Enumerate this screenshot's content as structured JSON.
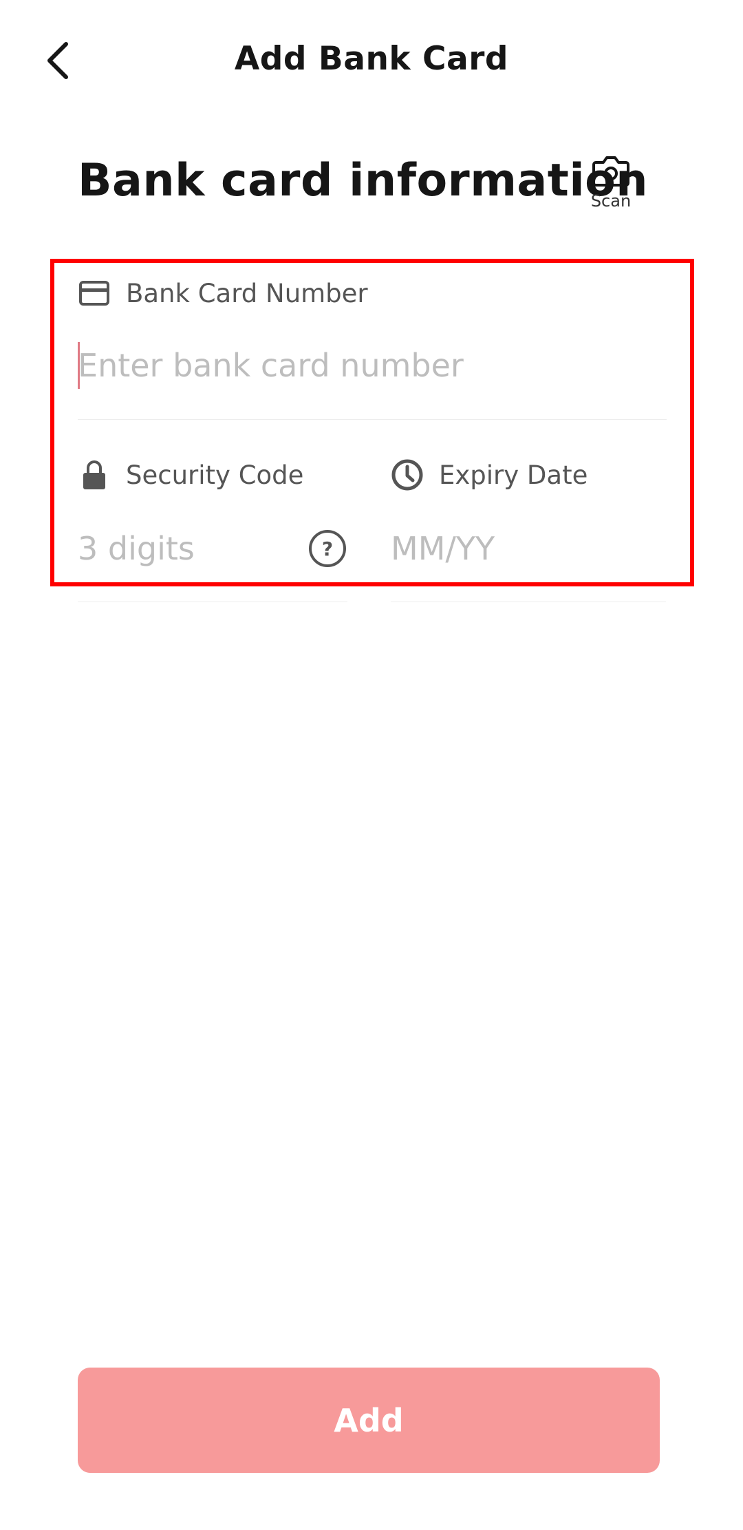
{
  "header": {
    "title": "Add Bank Card",
    "back_icon": "chevron-left-icon"
  },
  "section": {
    "title": "Bank card information",
    "scan_label": "Scan",
    "scan_icon": "camera-icon"
  },
  "card_number": {
    "label": "Bank Card Number",
    "icon": "credit-card-icon",
    "placeholder": "Enter bank card number",
    "value": ""
  },
  "security_code": {
    "label": "Security Code",
    "icon": "lock-icon",
    "placeholder": "3 digits",
    "value": "",
    "help_icon": "question-circle-icon"
  },
  "expiry_date": {
    "label": "Expiry Date",
    "icon": "clock-icon",
    "placeholder": "MM/YY",
    "value": ""
  },
  "actions": {
    "add_label": "Add"
  },
  "colors": {
    "highlight": "#ff0000",
    "add_button": "#f79a9a",
    "placeholder": "#bdbdbd",
    "caret": "#e07a85"
  }
}
